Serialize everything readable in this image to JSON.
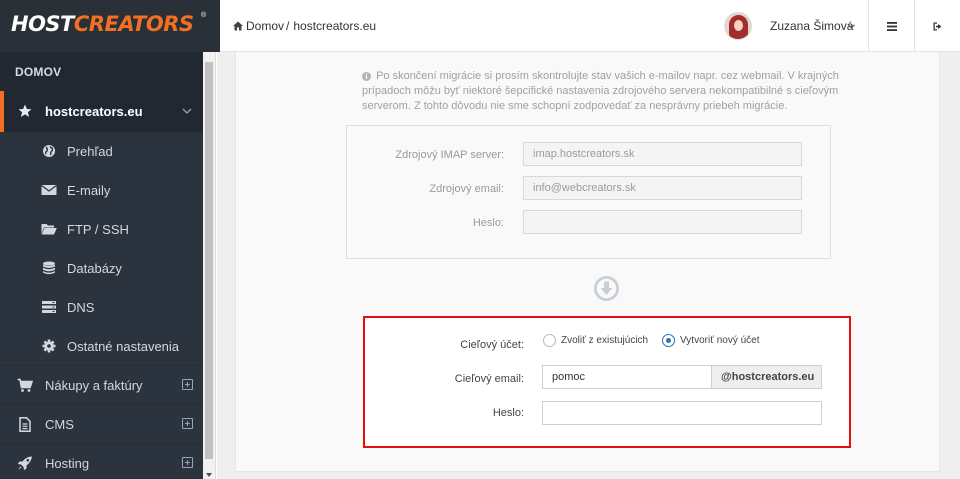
{
  "brand": {
    "logo_white": "HOST",
    "logo_orange": "CREATORS",
    "reg": "®"
  },
  "breadcrumb": {
    "home": "Domov",
    "separator": "/",
    "current": "hostcreators.eu"
  },
  "user": {
    "name": "Zuzana Šimová"
  },
  "header_icons": {
    "menu": "hamburger-icon",
    "logout": "sign-out-icon"
  },
  "sidebar": {
    "section_title": "DOMOV",
    "domain": {
      "label": "hostcreators.eu",
      "icon": "star-icon"
    },
    "sub_items": [
      {
        "label": "Prehľad",
        "icon": "globe-icon"
      },
      {
        "label": "E-maily",
        "icon": "envelope-icon"
      },
      {
        "label": "FTP / SSH",
        "icon": "folder-open-icon"
      },
      {
        "label": "Databázy",
        "icon": "database-icon"
      },
      {
        "label": "DNS",
        "icon": "server-icon"
      },
      {
        "label": "Ostatné nastavenia",
        "icon": "gear-icon"
      }
    ],
    "main_items": [
      {
        "label": "Nákupy a faktúry",
        "icon": "cart-icon"
      },
      {
        "label": "CMS",
        "icon": "file-icon"
      },
      {
        "label": "Hosting",
        "icon": "rocket-icon"
      }
    ]
  },
  "notice": "Po skončení migrácie si prosím skontrolujte stav vašich e-mailov napr. cez webmail. V krajných prípadoch môžu byť niektoré šepcifické nastavenia zdrojového servera nekompatibilné s cieľovým serverom. Z tohto dôvodu nie sme schopní zodpovedať za nesprávny priebeh migrácie.",
  "source": {
    "imap_label": "Zdrojový IMAP server:",
    "imap_value": "imap.hostcreators.sk",
    "email_label": "Zdrojový email:",
    "email_value": "info@webcreators.sk",
    "password_label": "Heslo:",
    "password_value": ""
  },
  "target": {
    "account_label": "Cieľový účet:",
    "option_existing": "Zvoliť z existujúcich",
    "option_new": "Vytvoriť nový účet",
    "selected": "Vytvoriť nový účet",
    "email_label": "Cieľový email:",
    "email_value": "pomoc",
    "email_domain": "@hostcreators.eu",
    "password_label": "Heslo:",
    "password_value": ""
  },
  "colors": {
    "accent": "#f36f21",
    "sidebar": "#2b333e",
    "highlight_border": "#e01010",
    "radio": "#2f6fb3"
  }
}
